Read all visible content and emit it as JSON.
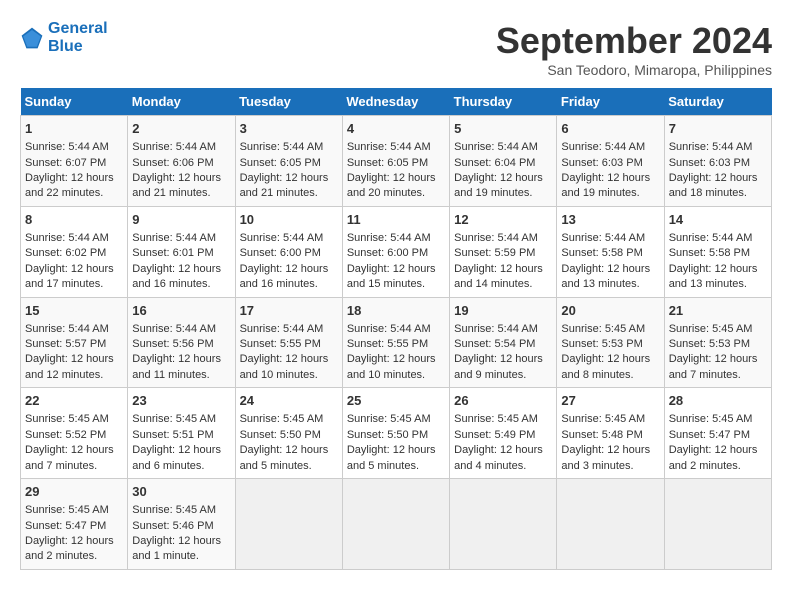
{
  "header": {
    "logo_line1": "General",
    "logo_line2": "Blue",
    "month": "September 2024",
    "location": "San Teodoro, Mimaropa, Philippines"
  },
  "days_of_week": [
    "Sunday",
    "Monday",
    "Tuesday",
    "Wednesday",
    "Thursday",
    "Friday",
    "Saturday"
  ],
  "weeks": [
    [
      {
        "day": "1",
        "sunrise": "5:44 AM",
        "sunset": "6:07 PM",
        "daylight": "12 hours and 22 minutes."
      },
      {
        "day": "2",
        "sunrise": "5:44 AM",
        "sunset": "6:06 PM",
        "daylight": "12 hours and 21 minutes."
      },
      {
        "day": "3",
        "sunrise": "5:44 AM",
        "sunset": "6:05 PM",
        "daylight": "12 hours and 21 minutes."
      },
      {
        "day": "4",
        "sunrise": "5:44 AM",
        "sunset": "6:05 PM",
        "daylight": "12 hours and 20 minutes."
      },
      {
        "day": "5",
        "sunrise": "5:44 AM",
        "sunset": "6:04 PM",
        "daylight": "12 hours and 19 minutes."
      },
      {
        "day": "6",
        "sunrise": "5:44 AM",
        "sunset": "6:03 PM",
        "daylight": "12 hours and 19 minutes."
      },
      {
        "day": "7",
        "sunrise": "5:44 AM",
        "sunset": "6:03 PM",
        "daylight": "12 hours and 18 minutes."
      }
    ],
    [
      {
        "day": "8",
        "sunrise": "5:44 AM",
        "sunset": "6:02 PM",
        "daylight": "12 hours and 17 minutes."
      },
      {
        "day": "9",
        "sunrise": "5:44 AM",
        "sunset": "6:01 PM",
        "daylight": "12 hours and 16 minutes."
      },
      {
        "day": "10",
        "sunrise": "5:44 AM",
        "sunset": "6:00 PM",
        "daylight": "12 hours and 16 minutes."
      },
      {
        "day": "11",
        "sunrise": "5:44 AM",
        "sunset": "6:00 PM",
        "daylight": "12 hours and 15 minutes."
      },
      {
        "day": "12",
        "sunrise": "5:44 AM",
        "sunset": "5:59 PM",
        "daylight": "12 hours and 14 minutes."
      },
      {
        "day": "13",
        "sunrise": "5:44 AM",
        "sunset": "5:58 PM",
        "daylight": "12 hours and 13 minutes."
      },
      {
        "day": "14",
        "sunrise": "5:44 AM",
        "sunset": "5:58 PM",
        "daylight": "12 hours and 13 minutes."
      }
    ],
    [
      {
        "day": "15",
        "sunrise": "5:44 AM",
        "sunset": "5:57 PM",
        "daylight": "12 hours and 12 minutes."
      },
      {
        "day": "16",
        "sunrise": "5:44 AM",
        "sunset": "5:56 PM",
        "daylight": "12 hours and 11 minutes."
      },
      {
        "day": "17",
        "sunrise": "5:44 AM",
        "sunset": "5:55 PM",
        "daylight": "12 hours and 10 minutes."
      },
      {
        "day": "18",
        "sunrise": "5:44 AM",
        "sunset": "5:55 PM",
        "daylight": "12 hours and 10 minutes."
      },
      {
        "day": "19",
        "sunrise": "5:44 AM",
        "sunset": "5:54 PM",
        "daylight": "12 hours and 9 minutes."
      },
      {
        "day": "20",
        "sunrise": "5:45 AM",
        "sunset": "5:53 PM",
        "daylight": "12 hours and 8 minutes."
      },
      {
        "day": "21",
        "sunrise": "5:45 AM",
        "sunset": "5:53 PM",
        "daylight": "12 hours and 7 minutes."
      }
    ],
    [
      {
        "day": "22",
        "sunrise": "5:45 AM",
        "sunset": "5:52 PM",
        "daylight": "12 hours and 7 minutes."
      },
      {
        "day": "23",
        "sunrise": "5:45 AM",
        "sunset": "5:51 PM",
        "daylight": "12 hours and 6 minutes."
      },
      {
        "day": "24",
        "sunrise": "5:45 AM",
        "sunset": "5:50 PM",
        "daylight": "12 hours and 5 minutes."
      },
      {
        "day": "25",
        "sunrise": "5:45 AM",
        "sunset": "5:50 PM",
        "daylight": "12 hours and 5 minutes."
      },
      {
        "day": "26",
        "sunrise": "5:45 AM",
        "sunset": "5:49 PM",
        "daylight": "12 hours and 4 minutes."
      },
      {
        "day": "27",
        "sunrise": "5:45 AM",
        "sunset": "5:48 PM",
        "daylight": "12 hours and 3 minutes."
      },
      {
        "day": "28",
        "sunrise": "5:45 AM",
        "sunset": "5:47 PM",
        "daylight": "12 hours and 2 minutes."
      }
    ],
    [
      {
        "day": "29",
        "sunrise": "5:45 AM",
        "sunset": "5:47 PM",
        "daylight": "12 hours and 2 minutes."
      },
      {
        "day": "30",
        "sunrise": "5:45 AM",
        "sunset": "5:46 PM",
        "daylight": "12 hours and 1 minute."
      },
      null,
      null,
      null,
      null,
      null
    ]
  ]
}
